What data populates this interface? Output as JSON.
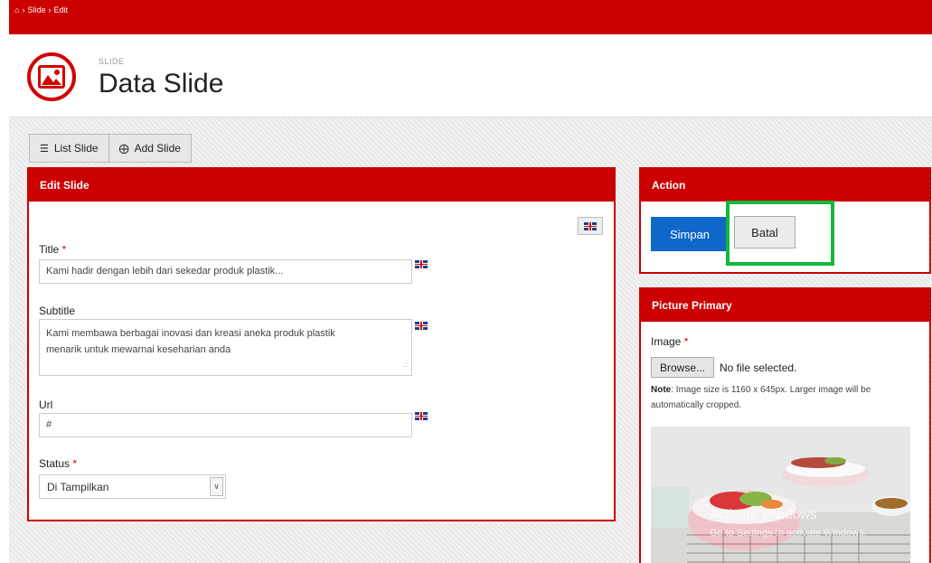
{
  "breadcrumb": {
    "items": [
      "Slide",
      "Edit"
    ]
  },
  "header": {
    "section_label": "SLIDE",
    "title": "Data Slide"
  },
  "tabs": [
    {
      "label": "List Slide",
      "icon": "list-icon"
    },
    {
      "label": "Add Slide",
      "icon": "plus-circle-icon"
    }
  ],
  "edit_panel": {
    "heading": "Edit Slide",
    "fields": {
      "title": {
        "label": "Title",
        "required": true,
        "value": "Kami hadir dengan lebih dari sekedar produk plastik..."
      },
      "subtitle": {
        "label": "Subtitle",
        "required": false,
        "value_line1": "Kami membawa berbagai inovasi dan kreasi aneka produk plastik",
        "value_line2": "menarik untuk mewarnai keseharian anda"
      },
      "url": {
        "label": "Url",
        "required": false,
        "value": "#"
      },
      "status": {
        "label": "Status",
        "required": true,
        "selected": "Di Tampilkan"
      }
    }
  },
  "action_panel": {
    "heading": "Action",
    "save_label": "Simpan",
    "cancel_label": "Batal"
  },
  "picture_panel": {
    "heading": "Picture Primary",
    "image_label": "Image",
    "browse_label": "Browse...",
    "file_status": "No file selected.",
    "note_bold": "Note",
    "note_text": ": Image size is 1160 x 645px. Larger image will be automatically cropped."
  },
  "watermark": {
    "line1": "Activate Windows",
    "line2": "Go to Settings to activate Windows."
  },
  "colors": {
    "brand_red": "#cc0000",
    "save_blue": "#0e67c9",
    "highlight_green": "#12b83c"
  }
}
